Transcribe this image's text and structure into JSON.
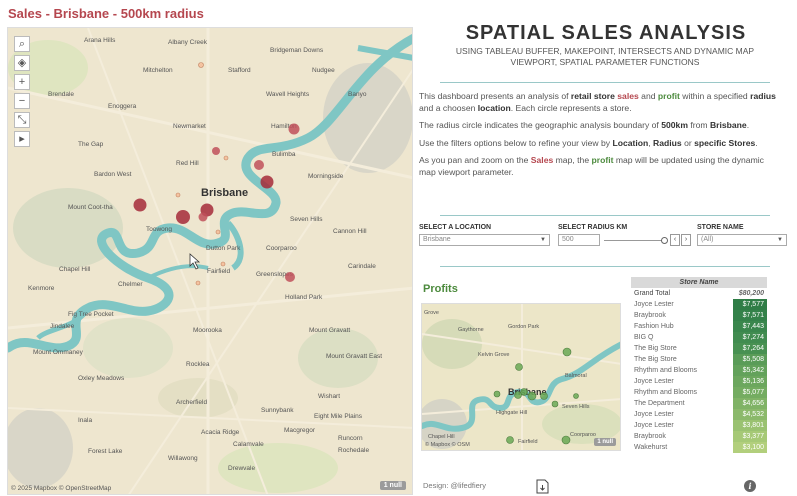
{
  "sales_map": {
    "title": "Sales - Brisbane - 500km radius",
    "attribution": "© 2025 Mapbox © OpenStreetMap",
    "null_badge": "1 null",
    "tools": [
      "⌕",
      "◈",
      "+",
      "−",
      "⤡",
      "▸"
    ],
    "tool_icons": [
      "search-icon",
      "layers-icon",
      "zoom-in-icon",
      "zoom-out-icon",
      "pan-icon",
      "play-icon"
    ],
    "places": [
      {
        "name": "Arana Hills"
      },
      {
        "name": "Albany Creek"
      },
      {
        "name": "Bridgeman Downs"
      },
      {
        "name": "Mitchelton"
      },
      {
        "name": "Stafford"
      },
      {
        "name": "Nudgee"
      },
      {
        "name": "Wavell Heights"
      },
      {
        "name": "Banyo"
      },
      {
        "name": "Brendale"
      },
      {
        "name": "Newmarket"
      },
      {
        "name": "Enoggera"
      },
      {
        "name": "Hamilton"
      },
      {
        "name": "The Gap"
      },
      {
        "name": "Bulimba"
      },
      {
        "name": "Red Hill"
      },
      {
        "name": "Bardon West"
      },
      {
        "name": "Morningside"
      },
      {
        "name": "Mount Coot-tha"
      },
      {
        "name": "Brisbane"
      },
      {
        "name": "Toowong"
      },
      {
        "name": "Seven Hills"
      },
      {
        "name": "Carindale"
      },
      {
        "name": "Cannon Hill"
      },
      {
        "name": "Dutton Park"
      },
      {
        "name": "Chapel Hill"
      },
      {
        "name": "Coorparoo"
      },
      {
        "name": "Fairfield"
      },
      {
        "name": "Greenslopes"
      },
      {
        "name": "Kenmore"
      },
      {
        "name": "Chelmer"
      },
      {
        "name": "Holland Park"
      },
      {
        "name": "Fig Tree Pocket"
      },
      {
        "name": "Jindalee"
      },
      {
        "name": "Moorooka"
      },
      {
        "name": "Mount Gravatt"
      },
      {
        "name": "Mount Ommaney"
      },
      {
        "name": "Mount Gravatt East"
      },
      {
        "name": "Oxley Meadows"
      },
      {
        "name": "Rocklea"
      },
      {
        "name": "Archerfield"
      },
      {
        "name": "Sunnybank"
      },
      {
        "name": "Inala"
      },
      {
        "name": "Acacia Ridge"
      },
      {
        "name": "Eight Mile Plains"
      },
      {
        "name": "Forest Lake"
      },
      {
        "name": "Calamvale"
      },
      {
        "name": "Willawong"
      },
      {
        "name": "Drewvale"
      },
      {
        "name": "Rochedale"
      },
      {
        "name": "Wishart"
      },
      {
        "name": "Macgregor"
      },
      {
        "name": "Runcorn"
      }
    ]
  },
  "header": {
    "title": "SPATIAL SALES ANALYSIS",
    "subtitle": "USING TABLEAU BUFFER, MAKEPOINT, INTERSECTS AND DYNAMIC MAP VIEWPORT, SPATIAL PARAMETER FUNCTIONS"
  },
  "intro": {
    "p1": [
      "This dashboard presents an analysis of ",
      "retail store ",
      "sales",
      " and ",
      "profit",
      " within a specified ",
      "radius",
      " and a choosen ",
      "location",
      ". Each circle represents a store."
    ],
    "p2": [
      "The radius circle indicates the geographic analysis boundary of ",
      "500km",
      " from ",
      "Brisbane",
      "."
    ],
    "p3": [
      "Use the filters options below to refine your view by ",
      "Location",
      ", ",
      "Radius",
      " or ",
      "specific Stores",
      "."
    ],
    "p4": [
      "As you pan and zoom on the ",
      "Sales",
      " map, the ",
      "profit",
      " map will be updated using the dynamic map viewport parameter."
    ]
  },
  "filters": {
    "location_label": "SELECT A LOCATION",
    "location_value": "Brisbane",
    "radius_label": "SELECT RADIUS KM",
    "radius_value": "500",
    "store_label": "STORE NAME",
    "store_value": "(All)"
  },
  "profits": {
    "title": "Profits",
    "attribution": "© Mapbox © OSM",
    "null_badge": "1 null",
    "places": [
      {
        "name": "Grove"
      },
      {
        "name": "Gaythorne"
      },
      {
        "name": "Gordon Park"
      },
      {
        "name": "Kelvin Grove"
      },
      {
        "name": "Balmoral"
      },
      {
        "name": "Brisbane"
      },
      {
        "name": "Highgate Hill"
      },
      {
        "name": "Seven Hills"
      },
      {
        "name": "Chapel Hill"
      },
      {
        "name": "Coorparoo"
      },
      {
        "name": "Fairfield"
      }
    ]
  },
  "store_table": {
    "header": "Store Name",
    "rows": [
      {
        "name": "Grand Total",
        "value": "$80,200",
        "color": "#ffffff"
      },
      {
        "name": "Joyce Lester",
        "value": "$7,577",
        "color": "#2f7d46"
      },
      {
        "name": "Braybrook",
        "value": "$7,571",
        "color": "#34824a"
      },
      {
        "name": "Fashion Hub",
        "value": "$7,443",
        "color": "#3a874d"
      },
      {
        "name": "BIG Q",
        "value": "$7,274",
        "color": "#418c50"
      },
      {
        "name": "The Big Store",
        "value": "$7,264",
        "color": "#489152"
      },
      {
        "name": "The Big Store",
        "value": "$5,508",
        "color": "#5a9c58"
      },
      {
        "name": "Rhythm and Blooms",
        "value": "$5,342",
        "color": "#63a25b"
      },
      {
        "name": "Joyce Lester",
        "value": "$5,136",
        "color": "#6ca75e"
      },
      {
        "name": "Rhythm and Blooms",
        "value": "$5,077",
        "color": "#74ac61"
      },
      {
        "name": "The Department",
        "value": "$4,656",
        "color": "#80b366"
      },
      {
        "name": "Joyce Lester",
        "value": "$4,532",
        "color": "#8bb96b"
      },
      {
        "name": "Joyce Lester",
        "value": "$3,801",
        "color": "#9ac271"
      },
      {
        "name": "Braybrook",
        "value": "$3,377",
        "color": "#a6c976"
      },
      {
        "name": "Wakehurst",
        "value": "$3,100",
        "color": "#b2cf7c"
      }
    ]
  },
  "footer": {
    "design": "Design: @lifedfiery"
  }
}
